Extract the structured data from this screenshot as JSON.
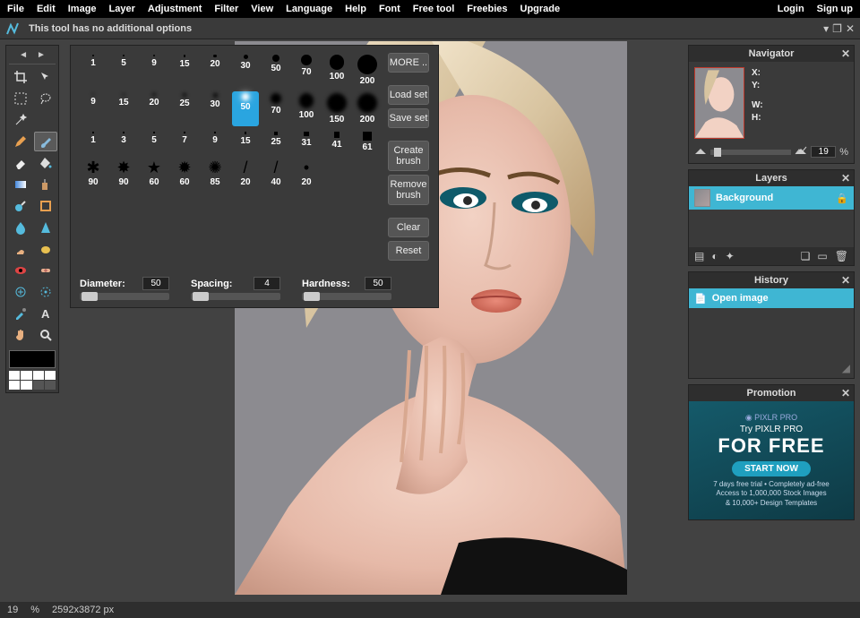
{
  "menu": {
    "items": [
      "File",
      "Edit",
      "Image",
      "Layer",
      "Adjustment",
      "Filter",
      "View",
      "Language",
      "Help",
      "Font",
      "Free tool",
      "Freebies",
      "Upgrade"
    ],
    "login": "Login",
    "signup": "Sign up"
  },
  "optionsbar": {
    "msg": "This tool has no additional options"
  },
  "brush": {
    "rows": [
      {
        "sizes": [
          1,
          5,
          9,
          15,
          20,
          30,
          50,
          70,
          100,
          200
        ],
        "type": "dot"
      },
      {
        "sizes": [
          9,
          15,
          20,
          25,
          30,
          50,
          70,
          100,
          150,
          200
        ],
        "type": "soft",
        "selectedIndex": 5
      },
      {
        "sizes": [
          1,
          3,
          5,
          7,
          9,
          15,
          25,
          31,
          41,
          61
        ],
        "type": "square"
      },
      {
        "sizes": [
          90,
          90,
          60,
          60,
          85,
          20,
          40,
          20
        ],
        "type": "shape"
      }
    ],
    "buttons": {
      "more": "MORE ..",
      "load": "Load set",
      "save": "Save set",
      "create": "Create brush",
      "remove": "Remove brush",
      "clear": "Clear",
      "reset": "Reset"
    },
    "controls": {
      "diameter": {
        "label": "Diameter:",
        "value": "50"
      },
      "spacing": {
        "label": "Spacing:",
        "value": "4"
      },
      "hardness": {
        "label": "Hardness:",
        "value": "50"
      }
    }
  },
  "navigator": {
    "title": "Navigator",
    "x": "X:",
    "y": "Y:",
    "w": "W:",
    "h": "H:",
    "zoom": "19",
    "pct": "%"
  },
  "layers": {
    "title": "Layers",
    "background": "Background"
  },
  "history": {
    "title": "History",
    "open": "Open image"
  },
  "promotion": {
    "title": "Promotion",
    "brand": "◉ PIXLR PRO",
    "try": "Try PIXLR PRO",
    "big": "FOR FREE",
    "start": "START NOW",
    "line1": "7 days free trial • Completely ad-free",
    "line2": "Access to 1,000,000 Stock Images",
    "line3": "& 10,000+ Design Templates"
  },
  "status": {
    "zoom": "19",
    "pct": "%",
    "dims": "2592x3872 px"
  }
}
